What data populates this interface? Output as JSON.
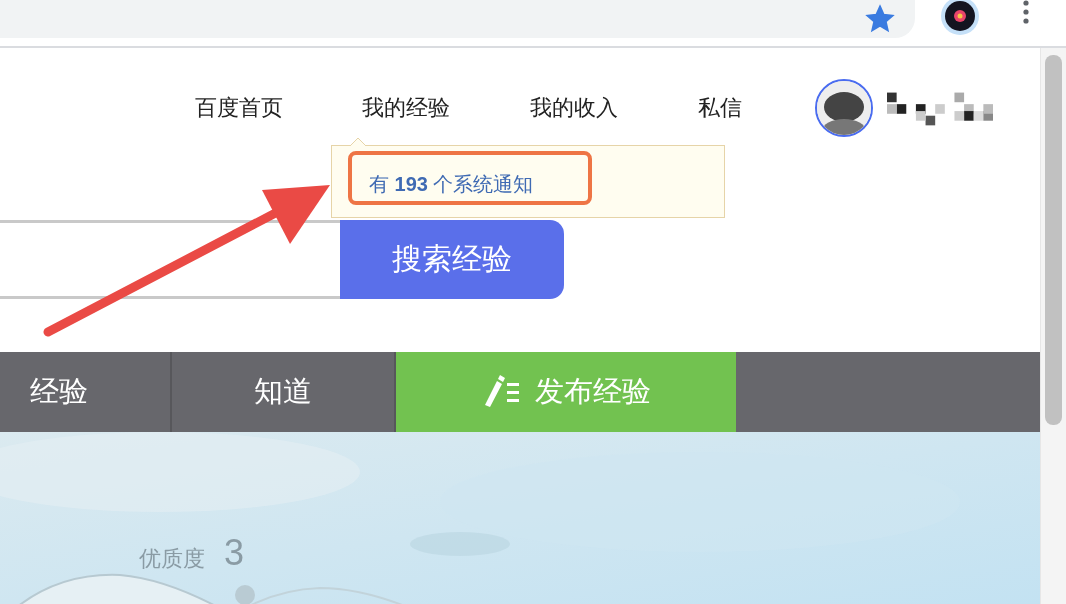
{
  "browser": {
    "bookmarked": true
  },
  "nav": [
    {
      "label": "百度首页"
    },
    {
      "label": "我的经验"
    },
    {
      "label": "我的收入"
    },
    {
      "label": "私信"
    }
  ],
  "notification": {
    "text": "有 **193** 个系统通知"
  },
  "search": {
    "button": "搜索经验"
  },
  "categories": [
    {
      "label": "经验",
      "kind": "tab"
    },
    {
      "label": "知道",
      "kind": "tab"
    },
    {
      "label": "发布经验",
      "kind": "publish"
    }
  ],
  "banner": {
    "kind": "picture",
    "caption": "优质度",
    "score": "3"
  }
}
